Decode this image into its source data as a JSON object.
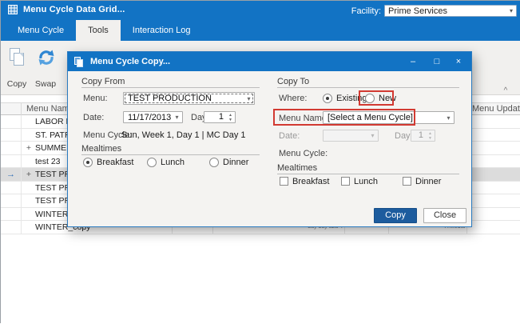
{
  "window": {
    "title": "Menu Cycle Data Grid...",
    "minimize": "–",
    "maximize": "□",
    "close": "×"
  },
  "tabbar": {
    "tabs": [
      {
        "label": "Menu Cycle"
      },
      {
        "label": "Tools"
      },
      {
        "label": "Interaction Log"
      }
    ],
    "active_tab": "Tools",
    "facility_label": "Facility:",
    "facility_value": "Prime Services"
  },
  "toolbar": {
    "copy_label": "Copy",
    "swap_label": "Swap",
    "collapse_glyph": "^"
  },
  "grid": {
    "columns": {
      "menu_name": "Menu Name",
      "menu_update": "Menu Update"
    },
    "rows": [
      {
        "expand": "",
        "name": "LABOR DA",
        "selected": false,
        "current": false
      },
      {
        "expand": "",
        "name": "ST. PATRI",
        "selected": false,
        "current": false
      },
      {
        "expand": "+",
        "name": "SUMMER 2",
        "selected": false,
        "current": false
      },
      {
        "expand": "",
        "name": "test 23",
        "selected": false,
        "current": false
      },
      {
        "expand": "+",
        "name": "TEST PRO",
        "selected": true,
        "current": true
      },
      {
        "expand": "",
        "name": "TEST PRO",
        "selected": false,
        "current": false
      },
      {
        "expand": "",
        "name": "TEST PRO",
        "selected": false,
        "current": false
      },
      {
        "expand": "",
        "name": "WINTER 2",
        "selected": false,
        "current": false
      },
      {
        "expand": "",
        "name": "WINTER_copy",
        "selected": false,
        "current": false,
        "mid_text": "bay bay aza 4",
        "right_text": "A Media"
      }
    ],
    "current_row_arrow": "→"
  },
  "dialog": {
    "title": "Menu Cycle Copy...",
    "minimize": "–",
    "maximize": "□",
    "close": "×",
    "copy_from": {
      "group_label": "Copy From",
      "menu_label": "Menu:",
      "menu_value": "TEST PRODUCTION",
      "date_label": "Date:",
      "date_value": "11/17/2013",
      "day_label": "Day:",
      "day_value": "1",
      "menu_cycle_label": "Menu Cycle:",
      "menu_cycle_value": "Sun, Week 1, Day 1 | MC Day 1",
      "mealtimes_label": "Mealtimes",
      "radios": [
        {
          "label": "Breakfast",
          "selected": true
        },
        {
          "label": "Lunch",
          "selected": false
        },
        {
          "label": "Dinner",
          "selected": false
        }
      ]
    },
    "copy_to": {
      "group_label": "Copy To",
      "where_label": "Where:",
      "radios": [
        {
          "label": "Existing",
          "selected": true
        },
        {
          "label": "New",
          "selected": false
        }
      ],
      "menu_name_label": "Menu Name:",
      "menu_name_value": "[Select a Menu Cycle]",
      "date_label": "Date:",
      "date_value": "",
      "day_label": "Day:",
      "day_value": "1",
      "menu_cycle_label": "Menu Cycle:",
      "menu_cycle_value": "",
      "mealtimes_label": "Mealtimes",
      "checkboxes": [
        {
          "label": "Breakfast",
          "checked": false
        },
        {
          "label": "Lunch",
          "checked": false
        },
        {
          "label": "Dinner",
          "checked": false
        }
      ]
    },
    "buttons": {
      "copy": "Copy",
      "close": "Close"
    }
  },
  "colors": {
    "accent_blue": "#1273C4",
    "copy_button_blue": "#1D5C9E",
    "highlight_red": "#D23A32"
  }
}
